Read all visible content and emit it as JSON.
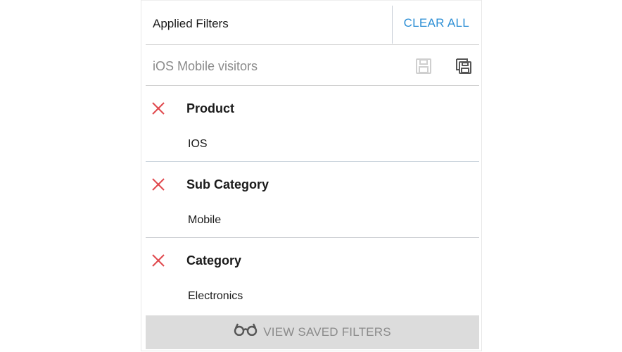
{
  "header": {
    "title": "Applied Filters",
    "clear_all_label": "CLEAR ALL"
  },
  "saved_filter": {
    "name": "iOS Mobile visitors",
    "save_icon": "save-icon",
    "save_as_icon": "save-as-icon"
  },
  "filters": [
    {
      "label": "Product",
      "value": "IOS"
    },
    {
      "label": "Sub Category",
      "value": "Mobile"
    },
    {
      "label": "Category",
      "value": "Electronics"
    }
  ],
  "footer": {
    "label": "VIEW SAVED FILTERS",
    "icon": "glasses-icon"
  },
  "colors": {
    "accent": "#2d8fd5",
    "remove": "#e0474c",
    "footer_bg": "#dcdcdc"
  }
}
